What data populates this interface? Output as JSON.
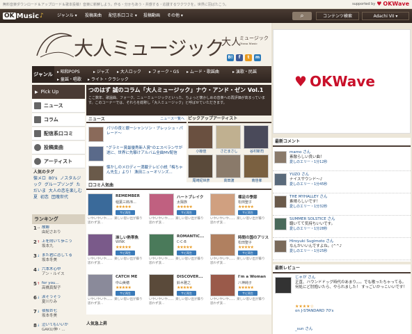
{
  "topbar": {
    "tagline": "無料音楽ダウンロード＆アップロード＆歌本投稿！音楽に新鮮しよう。作る・分かちあう・共感する・応援するワクワクを。世界に羽ばたこう。",
    "supported_by": "supported by",
    "supported_brand": "OKWave"
  },
  "nav": {
    "logo_ok": "OK",
    "logo_music": "Music",
    "items": [
      "ジャンル ▾",
      "投稿楽曲",
      "配信系口コミ ▾",
      "投稿動画",
      "その他 ▾"
    ],
    "search_icon": "search-icon",
    "content_search": "コンテンツ検索",
    "user": "Adachi VII ▾"
  },
  "banner": {
    "title": "大人ミュージック",
    "sub_title": "大人",
    "sub_small": "ミュージック",
    "sub_eng": "Otona Music",
    "share": [
      "B!",
      "f",
      "t",
      "m"
    ]
  },
  "genre": {
    "label": "ジャンル",
    "row1": [
      "▸ 昭和POPS",
      "▸ ジャズ",
      "▸ 大人ロック",
      "▸ フォーク・GS",
      "▸ ムード・歌謡曲",
      "▸ 演歌・民謡"
    ],
    "row2": [
      "▸ 童謡・唱歌",
      "▸ ライト・クラシック"
    ]
  },
  "sidebar": {
    "pickup": "Pick Up",
    "menu": [
      "ニュース",
      "コラム",
      "配信系口コミ",
      "投稿楽曲",
      "アーティスト"
    ],
    "tags_title": "人気のタグ",
    "tags": "懐メロ 80's ノスタルジック グループソング ただいま 大人の恋を楽しむ 夏 初恋 団塊世代",
    "ranking_title": "ランキング",
    "ranking": [
      {
        "num": "1",
        "arrow": "→",
        "title": "故郷",
        "artist": "由紀さおり"
      },
      {
        "num": "2",
        "arrow": "↑",
        "title": "上を向いて歩こう",
        "artist": "坂本九"
      },
      {
        "num": "3",
        "arrow": "↓",
        "title": "また君に恋してる",
        "artist": "坂本冬美"
      },
      {
        "num": "4",
        "arrow": "↓",
        "title": "六本木心中",
        "artist": "アン・ルイス"
      },
      {
        "num": "5",
        "arrow": "↑",
        "title": "for you…",
        "artist": "高橋真梨子"
      },
      {
        "num": "6",
        "arrow": "↓",
        "title": "涙そうそう",
        "artist": "夏川りみ"
      },
      {
        "num": "7",
        "arrow": "↓",
        "title": "夜桜お七",
        "artist": "坂本冬美"
      },
      {
        "num": "8",
        "arrow": "↓",
        "title": "泣いてもいいか",
        "artist": "GAKU/伸・..."
      }
    ]
  },
  "column": {
    "title": "つのはず 誠のコラム「大人ミュージック」ナウ・アンド・ゼン Vol.1",
    "body": "ここ数年、歌謡曲、フォーク、ニューミュージックといった、ちょっと懐かしめの音楽への再評価が高まっています。このコーナーでは、それらを総称し「大人ミュージック」と呼ばせていただきます。"
  },
  "news": {
    "title": "ニュース",
    "more": "ニュース一覧へ",
    "items": [
      "パリの夜と銀ーシャンソン・プレッシュ・パレード～",
      "\"グラミー賞最優秀新人賞\"のエスペランサが遂に、世界に先駆けアルバム全曲MV配信",
      "懐かしのメロディー満載テレビ小説「梅ちゃん先生」より！ 漁田ニューオリンズ..."
    ]
  },
  "pickup_artist": {
    "title": "ピックアップアーティスト",
    "artists": [
      "小椋佳",
      "さだまさし",
      "谷村新司",
      "尾崎紀世彦",
      "高田渡",
      "南佳孝"
    ]
  },
  "kuchikomi": {
    "title": "口コミ人気曲",
    "comment_text": "いやいやいや、、、、楽しい思い出が蘇り 思わず涙...",
    "buy_label": "サビ再生",
    "albums": [
      {
        "title": "REMEMBER",
        "artist": "稲葉三郎/B...",
        "stars": "★★★★★"
      },
      {
        "title": "ハートブレイク",
        "artist": "太陽族",
        "stars": "★★★★★"
      },
      {
        "title": "裸足の季節",
        "artist": "松田聖子",
        "stars": "★★★★★"
      },
      {
        "title": "淋しい熱帯魚",
        "artist": "WINK",
        "stars": "★★★★★"
      },
      {
        "title": "ROMANTIC...",
        "artist": "C-C-B",
        "stars": "★★★★★"
      },
      {
        "title": "時間の国のアリス",
        "artist": "松田聖子",
        "stars": "★★★★★"
      },
      {
        "title": "CATCH ME",
        "artist": "中山美穂",
        "stars": "★★★★★"
      },
      {
        "title": "DISCOVER...",
        "artist": "鈴木雅之",
        "stars": "★★★★★"
      },
      {
        "title": "I'm a Woman",
        "artist": "八神純子",
        "stars": "★★★★★"
      }
    ]
  },
  "rising": "人気急上昇",
  "ad": {
    "brand": "OKWave"
  },
  "recent_comments": {
    "title": "最新コメント",
    "items": [
      {
        "user": "mamo さん",
        "text": "素敵らしい良い曲！",
        "meta": "愛しのエリー・1分12秒"
      },
      {
        "user": "YUZO さん",
        "text": "ナイスサウンド～♪",
        "meta": "愛しのエリー・1分45秒"
      },
      {
        "user": "THE MYHALLEY さん",
        "text": "素晴らしいです！",
        "meta": "愛しのエリー・1分32秒"
      },
      {
        "user": "SUMMER SOLSTICE さん",
        "text": "聴いてて気持ちいいです。",
        "meta": "愛しのエリー・1分28秒"
      },
      {
        "user": "Hiroyuki Sugimoto さん",
        "text": "なんかいいんですよね。(^^♪",
        "meta": "愛しのエリー・1分25秒"
      }
    ]
  },
  "recent_reviews": {
    "title": "最新レビュー",
    "items": [
      {
        "user": "じゃが さん",
        "text": "正直、ハウンドドッグ時代のあまり。。。でも歌ったちゃってる。 何処にど肘抱いたら、やられました！ すっごいかっこいいです！",
        "stars": "★★★★☆",
        "album": "on J-STANDARD 70's"
      },
      {
        "user": "_sun さん",
        "text": "",
        "stars": "",
        "album": ""
      }
    ]
  }
}
